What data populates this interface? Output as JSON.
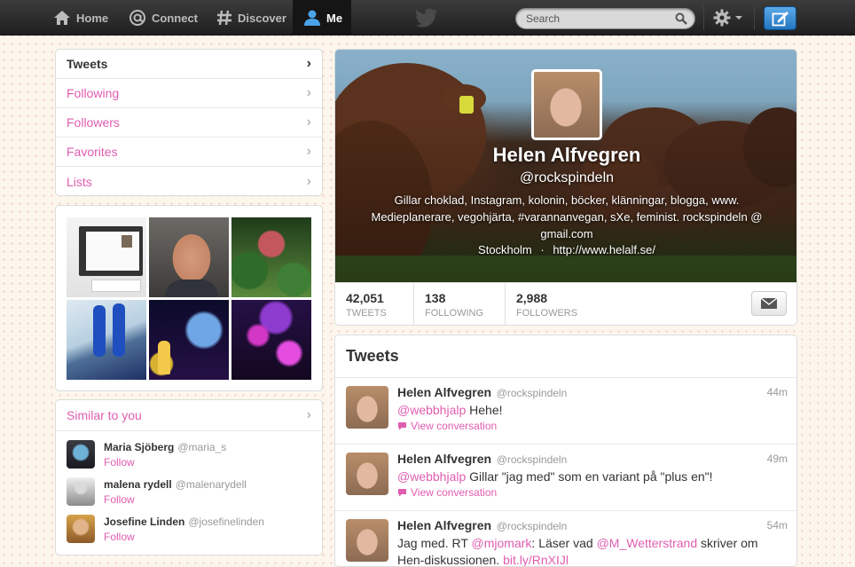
{
  "topbar": {
    "home_label": "Home",
    "connect_label": "Connect",
    "discover_label": "Discover",
    "me_label": "Me",
    "search_placeholder": "Search",
    "icons": [
      "home-icon",
      "at-icon",
      "hash-icon",
      "person-icon",
      "twitter-bird-icon",
      "search-icon",
      "gear-icon",
      "compose-icon"
    ]
  },
  "sidebar": {
    "nav": [
      {
        "label": "Tweets",
        "active": true
      },
      {
        "label": "Following"
      },
      {
        "label": "Followers"
      },
      {
        "label": "Favorites"
      },
      {
        "label": "Lists"
      }
    ],
    "similar": {
      "title": "Similar to you",
      "users": [
        {
          "name": "Maria Sjöberg",
          "handle": "@maria_s",
          "action": "Follow"
        },
        {
          "name": "malena rydell",
          "handle": "@malenarydell",
          "action": "Follow"
        },
        {
          "name": "Josefine Linden",
          "handle": "@josefinelinden",
          "action": "Follow"
        }
      ]
    }
  },
  "profile": {
    "name": "Helen Alfvegren",
    "handle": "@rockspindeln",
    "bio": "Gillar choklad, Instagram, kolonin, böcker, klänningar, blogga, www. Medieplanerare, vegohjärta, #varannanvegan, sXe, feminist. rockspindeln @ gmail.com",
    "location": "Stockholm",
    "separator": "·",
    "url": "http://www.helalf.se/",
    "stats": [
      {
        "value": "42,051",
        "label": "TWEETS"
      },
      {
        "value": "138",
        "label": "FOLLOWING"
      },
      {
        "value": "2,988",
        "label": "FOLLOWERS"
      }
    ]
  },
  "tweets": {
    "title": "Tweets",
    "items": [
      {
        "name": "Helen Alfvegren",
        "handle": "@rockspindeln",
        "time": "44m",
        "mention": "@webbhjalp",
        "text": " Hehe!",
        "conversation": "View conversation"
      },
      {
        "name": "Helen Alfvegren",
        "handle": "@rockspindeln",
        "time": "49m",
        "mention": "@webbhjalp",
        "text": " Gillar \"jag med\" som en variant på \"plus en\"!",
        "conversation": "View conversation"
      },
      {
        "name": "Helen Alfvegren",
        "handle": "@rockspindeln",
        "time": "54m",
        "text_parts": [
          "Jag med. RT ",
          "@mjomark",
          ": Läser vad ",
          "@M_Wetterstrand",
          " skriver om",
          "Hen-diskussionen. ",
          "bit.ly/RnXIJl"
        ]
      }
    ]
  },
  "colors": {
    "accent": "#e05db0",
    "topbar": "#2a2a2a",
    "compose": "#2f86d4",
    "background": "#fdf6ec"
  }
}
